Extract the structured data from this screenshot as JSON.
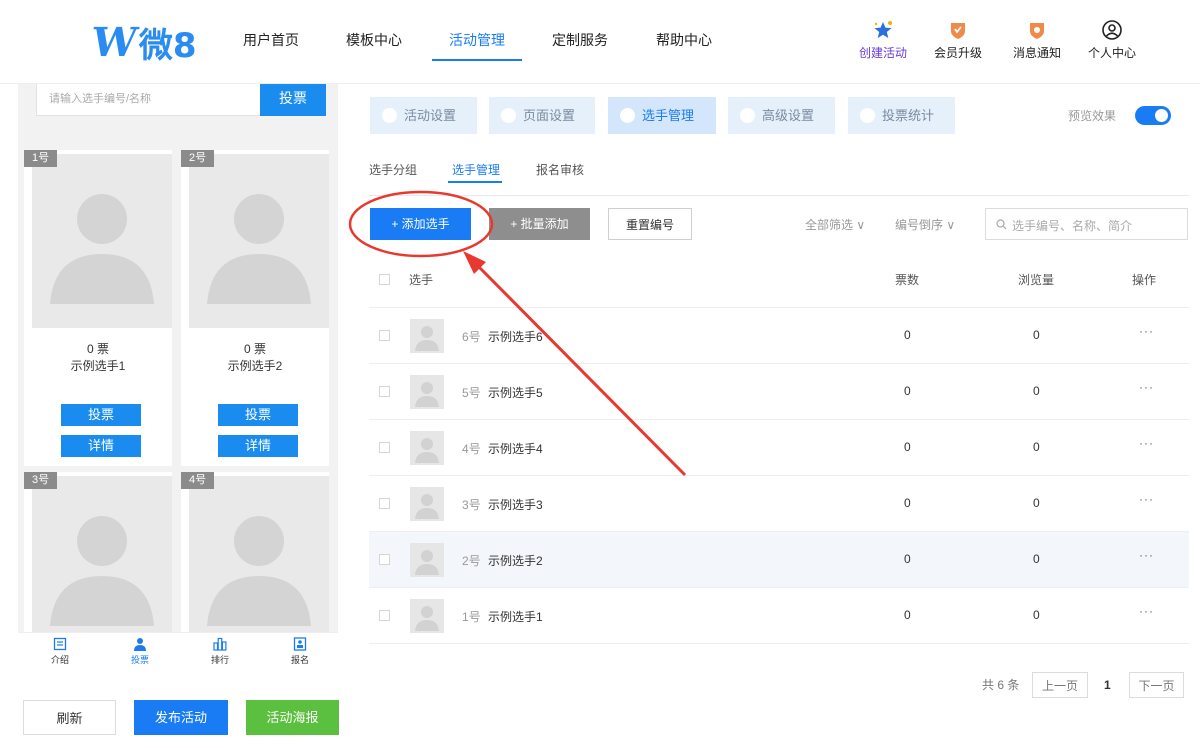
{
  "header": {
    "logo": {
      "mark": "W",
      "text": "微8"
    },
    "nav": [
      "用户首页",
      "模板中心",
      "活动管理",
      "定制服务",
      "帮助中心"
    ],
    "active_nav": "活动管理",
    "tools": [
      {
        "label": "创建活动",
        "icon": "star-plus-icon"
      },
      {
        "label": "会员升级",
        "icon": "vip-badge-icon"
      },
      {
        "label": "消息通知",
        "icon": "bell-badge-icon"
      },
      {
        "label": "个人中心",
        "icon": "user-circle-icon"
      }
    ]
  },
  "preview": {
    "search_placeholder": "请输入选手编号/名称",
    "search_button": "投票",
    "cards": [
      {
        "num": "1号",
        "votes": "0 票",
        "name": "示例选手1",
        "vote_btn": "投票",
        "detail_btn": "详情"
      },
      {
        "num": "2号",
        "votes": "0 票",
        "name": "示例选手2",
        "vote_btn": "投票",
        "detail_btn": "详情"
      },
      {
        "num": "3号"
      },
      {
        "num": "4号"
      }
    ],
    "tabs": [
      {
        "label": "介绍",
        "icon": "doc-icon"
      },
      {
        "label": "投票",
        "icon": "person-icon"
      },
      {
        "label": "排行",
        "icon": "bar-chart-icon"
      },
      {
        "label": "报名",
        "icon": "signup-icon"
      }
    ],
    "actions": {
      "refresh": "刷新",
      "publish": "发布活动",
      "poster": "活动海报"
    }
  },
  "settings_tabs": [
    "活动设置",
    "页面设置",
    "选手管理",
    "高级设置",
    "投票统计"
  ],
  "active_settings_tab": "选手管理",
  "preview_toggle": {
    "label": "预览效果",
    "on": true
  },
  "subtabs": [
    "选手分组",
    "选手管理",
    "报名审核"
  ],
  "toolbar": {
    "add": "+ 添加选手",
    "batch": "+ 批量添加",
    "reset": "重置编号",
    "filter_all": "全部筛选 ∨",
    "sort": "编号倒序 ∨",
    "search_placeholder": "选手编号、名称、简介"
  },
  "table": {
    "headers": {
      "player": "选手",
      "votes": "票数",
      "views": "浏览量",
      "actions": "操作"
    },
    "rows": [
      {
        "num": "6号",
        "name": "示例选手6",
        "votes": "0",
        "views": "0",
        "more": "···"
      },
      {
        "num": "5号",
        "name": "示例选手5",
        "votes": "0",
        "views": "0",
        "more": "···"
      },
      {
        "num": "4号",
        "name": "示例选手4",
        "votes": "0",
        "views": "0",
        "more": "···"
      },
      {
        "num": "3号",
        "name": "示例选手3",
        "votes": "0",
        "views": "0",
        "more": "···"
      },
      {
        "num": "2号",
        "name": "示例选手2",
        "votes": "0",
        "views": "0",
        "more": "···"
      },
      {
        "num": "1号",
        "name": "示例选手1",
        "votes": "0",
        "views": "0",
        "more": "···"
      }
    ]
  },
  "pagination": {
    "total": "共 6 条",
    "prev": "上一页",
    "page": "1",
    "next": "下一页"
  },
  "colors": {
    "primary": "#1a7cf5",
    "green": "#5bbf3f",
    "annotation": "#e8382f"
  }
}
